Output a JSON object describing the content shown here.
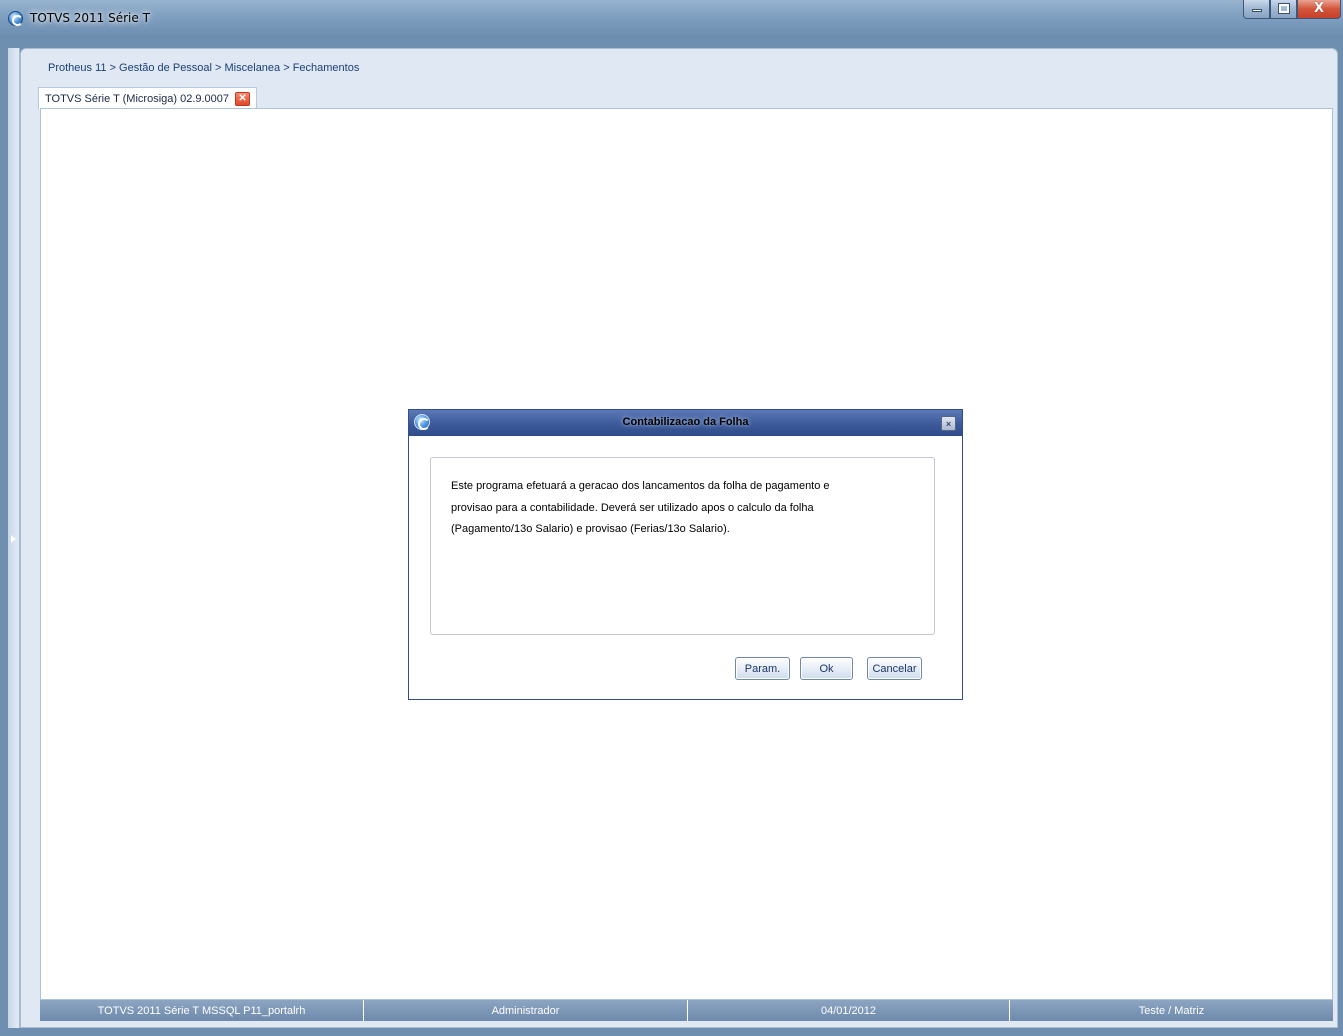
{
  "window": {
    "title": "TOTVS 2011 Série T",
    "minimize_glyph": "",
    "maximize_glyph": "",
    "close_glyph": "X"
  },
  "breadcrumb": "Protheus 11 > Gestão de Pessoal > Miscelanea > Fechamentos",
  "tabs": [
    {
      "label": "TOTVS Série T  (Microsiga) 02.9.0007",
      "close_glyph": "✕"
    }
  ],
  "dialog": {
    "title": "Contabilizacao da Folha",
    "close_glyph": "×",
    "message_lines": [
      "Este programa efetuará a geracao dos lancamentos da folha de pagamento e",
      "provisao para a contabilidade. Deverá ser utilizado apos o calculo da folha",
      "(Pagamento/13o Salario) e provisao (Ferias/13o Salario)."
    ],
    "buttons": {
      "param": "Param.",
      "ok": "Ok",
      "cancel": "Cancelar"
    }
  },
  "statusbar": {
    "environment": "TOTVS 2011 Série T  MSSQL P11_portalrh",
    "user": "Administrador",
    "date": "04/01/2012",
    "company": "Teste / Matriz"
  },
  "icons": {
    "app": "totvs-logo-icon",
    "dialog": "totvs-logo-icon",
    "tab_close": "close-icon"
  },
  "colors": {
    "titlebar": "#7f9fc0",
    "dialog_titlebar": "#3c5a9a",
    "statusbar": "#7a94b5",
    "tab_close": "#e0462a"
  }
}
